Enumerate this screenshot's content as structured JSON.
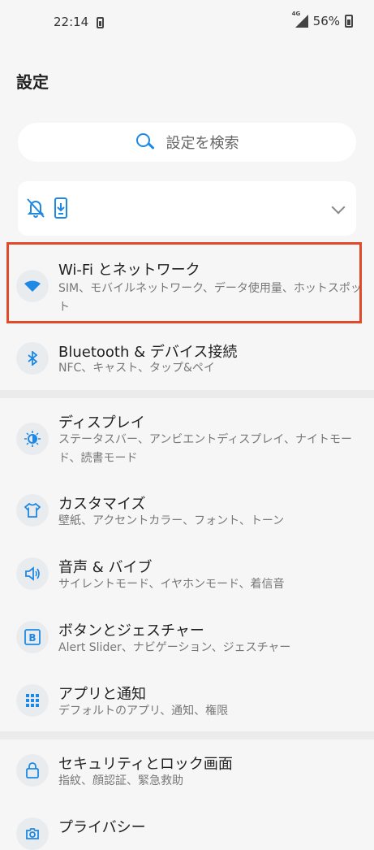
{
  "status_bar": {
    "time": "22:14",
    "network": "4G",
    "battery_percent": "56%"
  },
  "header": {
    "title": "設定"
  },
  "search": {
    "placeholder": "設定を検索"
  },
  "quick_settings": {
    "icons": [
      "bell-off-icon",
      "vibrate-icon"
    ],
    "expand": "chevron-down-icon"
  },
  "settings": [
    {
      "id": "wifi",
      "icon": "wifi-icon",
      "title": "Wi-Fi とネットワーク",
      "subtitle": "SIM、モバイルネットワーク、データ使用量、ホットスポット"
    },
    {
      "id": "bluetooth",
      "icon": "bluetooth-icon",
      "title": "Bluetooth & デバイス接続",
      "subtitle": "NFC、キャスト、タップ&ペイ"
    },
    {
      "id": "display",
      "icon": "brightness-icon",
      "title": "ディスプレイ",
      "subtitle": "ステータスバー、アンビエントディスプレイ、ナイトモード、読書モード"
    },
    {
      "id": "customize",
      "icon": "shirt-icon",
      "title": "カスタマイズ",
      "subtitle": "壁紙、アクセントカラー、フォント、トーン"
    },
    {
      "id": "sound",
      "icon": "speaker-icon",
      "title": "音声 & バイブ",
      "subtitle": "サイレントモード、イヤホンモード、着信音"
    },
    {
      "id": "buttons",
      "icon": "button-b-icon",
      "title": "ボタンとジェスチャー",
      "subtitle": "Alert Slider、ナビゲーション、ジェスチャー"
    },
    {
      "id": "apps",
      "icon": "apps-grid-icon",
      "title": "アプリと通知",
      "subtitle": "デフォルトのアプリ、通知、権限"
    },
    {
      "id": "security",
      "icon": "lock-icon",
      "title": "セキュリティとロック画面",
      "subtitle": "指紋、顔認証、緊急救助"
    },
    {
      "id": "privacy",
      "icon": "privacy-icon",
      "title": "プライバシー",
      "subtitle": ""
    }
  ],
  "colors": {
    "accent": "#1e88e5",
    "highlight": "#e04a2a",
    "background": "#f6f6f6"
  }
}
